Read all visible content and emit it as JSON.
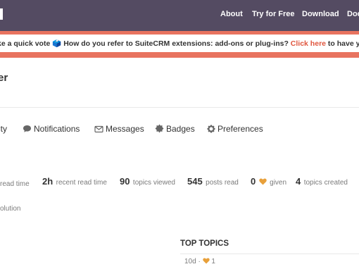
{
  "header": {
    "nav": [
      "About",
      "Try for Free",
      "Download",
      "Doc"
    ]
  },
  "banner": {
    "text": "ke a quick vote 🗳️ How do you refer to SuiteCRM extensions: add-ons or plug-ins? ",
    "link": "Click here",
    "suffix": " to have your sa"
  },
  "profile": {
    "username_fragment": "er"
  },
  "tabs": {
    "activity_fragment": "ity",
    "notifications": "Notifications",
    "messages": "Messages",
    "badges": "Badges",
    "preferences": "Preferences"
  },
  "stats": {
    "read_time_fragment_label": "read time",
    "recent_read_time_value": "2h",
    "recent_read_time_label": "recent read time",
    "topics_viewed_value": "90",
    "topics_viewed_label": "topics viewed",
    "posts_read_value": "545",
    "posts_read_label": "posts read",
    "likes_given_value": "0",
    "likes_given_label": "given",
    "topics_created_value": "4",
    "topics_created_label": "topics created"
  },
  "solution_fragment": "olution",
  "top_topics": {
    "title": "TOP TOPICS",
    "first_age": "10d",
    "first_likes": "1"
  },
  "colors": {
    "header_bg": "#544b62",
    "banner_accent": "#e8735f",
    "link": "#e0563e",
    "heart": "#e8a03a"
  }
}
